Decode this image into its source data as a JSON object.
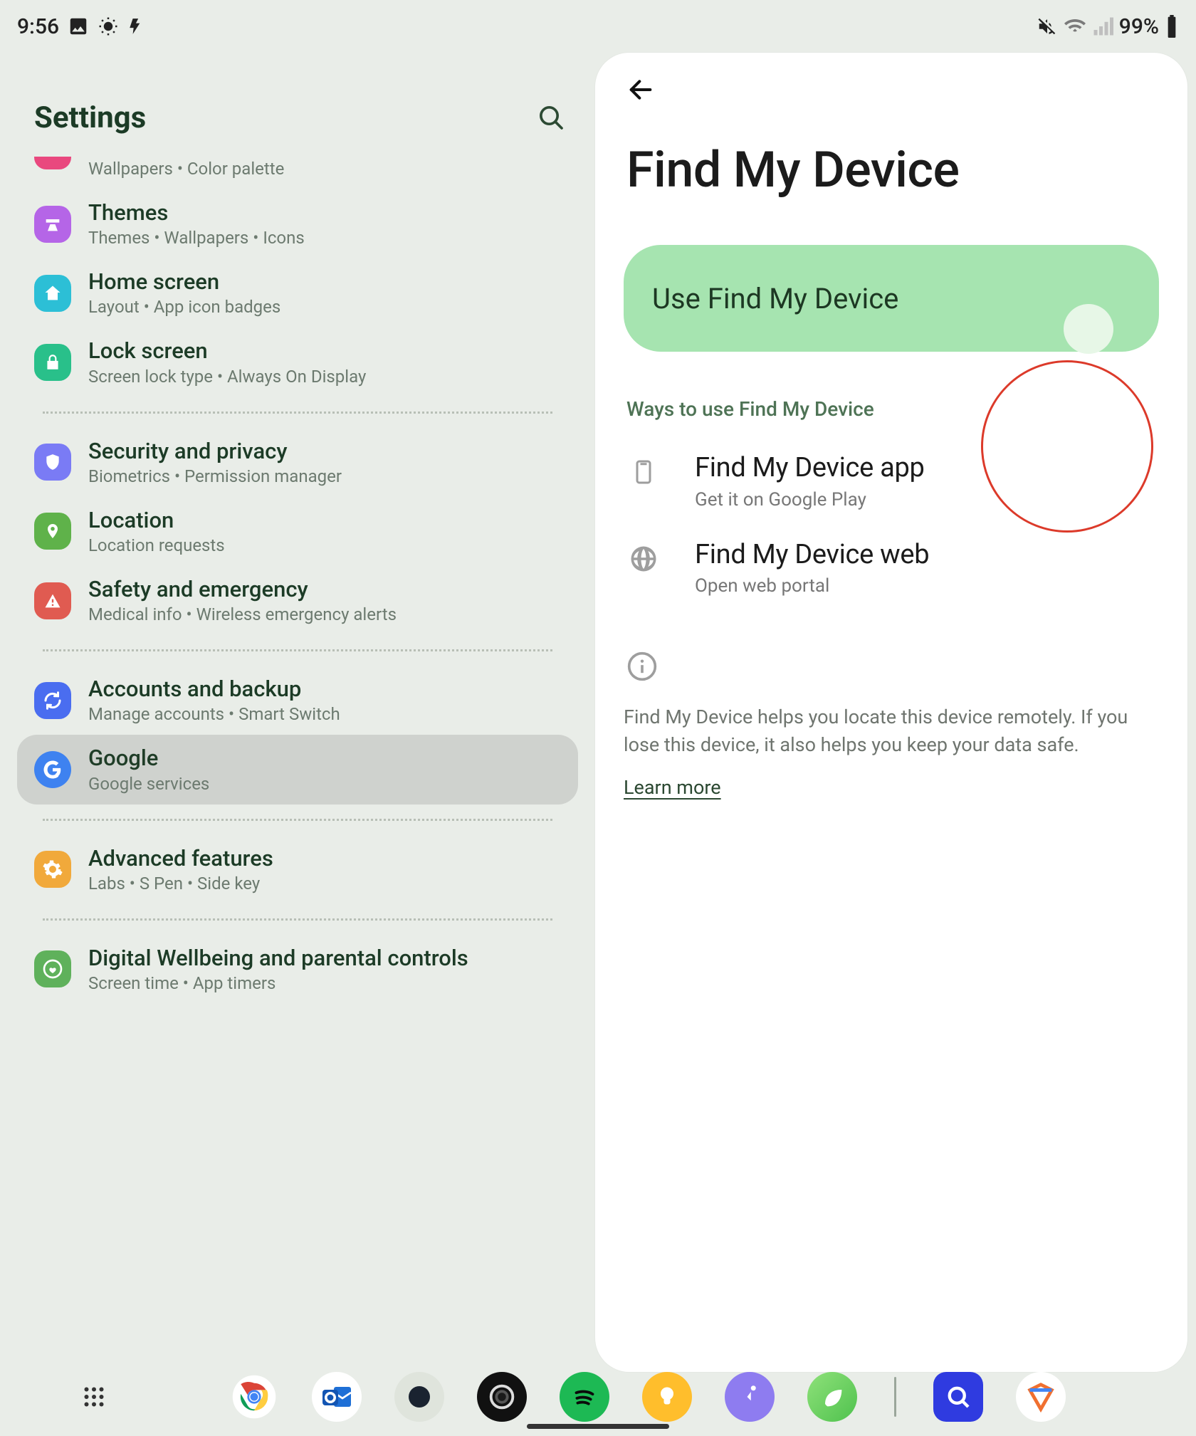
{
  "statusbar": {
    "time": "9:56",
    "battery_pct": "99%"
  },
  "sidebar": {
    "title": "Settings",
    "items": [
      {
        "icon_color": "#e9487e",
        "title": "",
        "sub": "Wallpapers  •  Color palette"
      },
      {
        "icon_color": "#b565e7",
        "title": "Themes",
        "sub": "Themes  •  Wallpapers  •  Icons"
      },
      {
        "icon_color": "#2cbfd6",
        "title": "Home screen",
        "sub": "Layout  •  App icon badges"
      },
      {
        "icon_color": "#29c08a",
        "title": "Lock screen",
        "sub": "Screen lock type  •  Always On Display"
      },
      {
        "icon_color": "#7a7bf5",
        "title": "Security and privacy",
        "sub": "Biometrics  •  Permission manager"
      },
      {
        "icon_color": "#5fb24a",
        "title": "Location",
        "sub": "Location requests"
      },
      {
        "icon_color": "#e05b51",
        "title": "Safety and emergency",
        "sub": "Medical info  •  Wireless emergency alerts"
      },
      {
        "icon_color": "#4a6df0",
        "title": "Accounts and backup",
        "sub": "Manage accounts  •  Smart Switch"
      },
      {
        "icon_color": "#3e82f0",
        "title": "Google",
        "sub": "Google services"
      },
      {
        "icon_color": "#f1a93b",
        "title": "Advanced features",
        "sub": "Labs  •  S Pen  •  Side key"
      },
      {
        "icon_color": "#5fb15b",
        "title": "Digital Wellbeing and parental controls",
        "sub": "Screen time  •  App timers"
      }
    ],
    "selected_index": 8
  },
  "detail": {
    "title": "Find My Device",
    "toggle_label": "Use Find My Device",
    "toggle_on": true,
    "section_caption": "Ways to use Find My Device",
    "options": [
      {
        "kind": "app",
        "title": "Find My Device app",
        "sub": "Get it on Google Play"
      },
      {
        "kind": "web",
        "title": "Find My Device web",
        "sub": "Open web portal"
      }
    ],
    "info_text": "Find My Device helps you locate this device remotely. If you lose this device, it also helps you keep your data safe.",
    "learn_more": "Learn more"
  },
  "taskbar": {
    "apps_before": [
      "chrome",
      "outlook",
      "moon",
      "galaxy-watch",
      "spotify",
      "smartthings",
      "samsung-health",
      "android-green"
    ],
    "apps_after": [
      "quicklook",
      "shortcuts"
    ]
  }
}
